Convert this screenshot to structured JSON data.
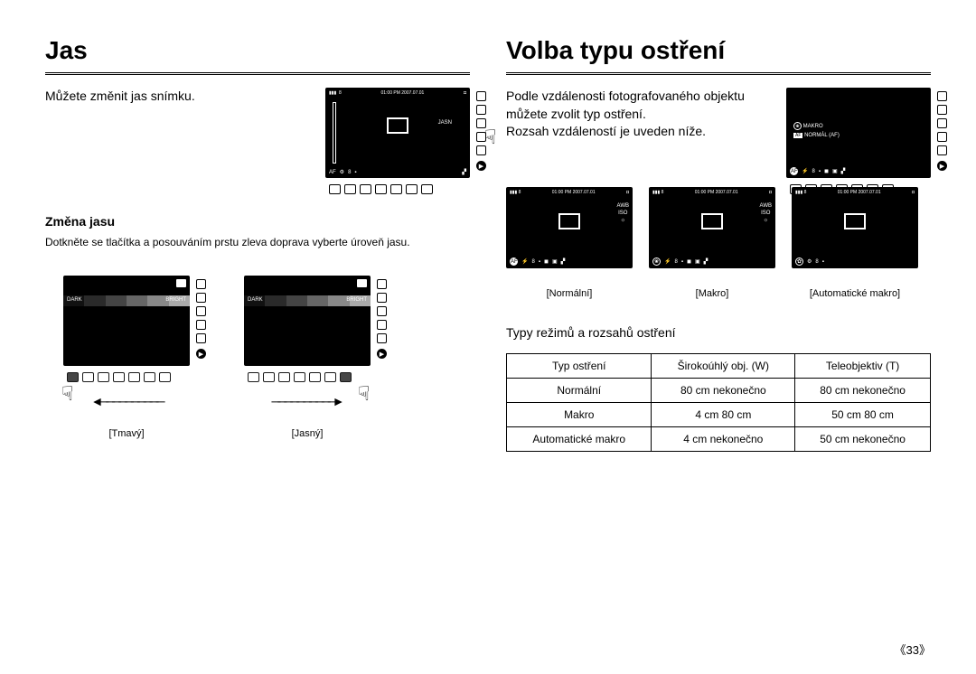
{
  "left": {
    "title": "Jas",
    "intro": "Můžete změnit jas snímku.",
    "section": "Změna jasu",
    "instruction": "Dotkněte se tlačítka a posouváním prstu zleva doprava vyberte úroveň jasu.",
    "dark_label": "[Tmavý]",
    "bright_label": "[Jasný]",
    "preview": {
      "timestamp": "01:00 PM 2007.07.01",
      "shots": "8",
      "jasn": "JASN",
      "af": "AF",
      "bar_dark": "DARK",
      "bar_bright": "BRIGHT"
    }
  },
  "right": {
    "title": "Volba typu ostření",
    "intro1": "Podle vzdálenosti fotografovaného objektu můžete zvolit typ ostření.",
    "intro2": "Rozsah vzdáleností je uveden níže.",
    "side_screen": {
      "makro": "MAKRO",
      "normal_af": "NORMÁL (AF)",
      "af": "AF"
    },
    "examples": {
      "timestamp": "01:00 PM 2007.07.01",
      "shots": "8",
      "labels": [
        "[Normální]",
        "[Makro]",
        "[Automatické makro]"
      ],
      "badges": [
        "AF",
        "",
        ""
      ],
      "side_mode": [
        "AWB",
        "ISO"
      ]
    },
    "table_title": "Typy režimů a rozsahů ostření",
    "table": {
      "headers": [
        "Typ ostření",
        "Širokoúhlý obj. (W)",
        "Teleobjektiv (T)"
      ],
      "rows": [
        [
          "Normální",
          "80 cm   nekonečno",
          "80 cm   nekonečno"
        ],
        [
          "Makro",
          "4 cm   80 cm",
          "50 cm   80 cm"
        ],
        [
          "Automatické makro",
          "4 cm   nekonečno",
          "50 cm   nekonečno"
        ]
      ]
    }
  },
  "page_number": "33"
}
